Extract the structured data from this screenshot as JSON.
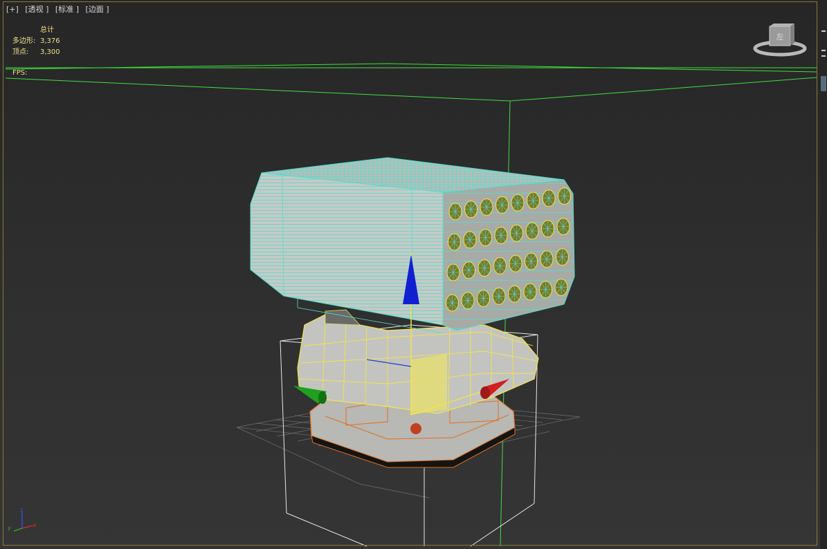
{
  "viewport": {
    "labels": [
      "[+]",
      "[透视 ]",
      "[标准 ]",
      "[边面 ]"
    ],
    "stats": {
      "header": "总计",
      "rows": [
        {
          "label": "多边形:",
          "value": "3,376"
        },
        {
          "label": "顶点:",
          "value": "3,300"
        }
      ]
    },
    "fps_label": "FPS:",
    "viewcube_label": "左",
    "axis_labels": {
      "x": "x",
      "y": "y",
      "z": "z"
    }
  },
  "colors": {
    "background": "#2b2b2b",
    "stats_text": "#f0e08a",
    "launcher_wire": "#4fe0d0",
    "base_wire": "#f4e44a",
    "bottom_wire": "#e07020",
    "axis_x": "#d02020",
    "axis_y": "#20a020",
    "axis_z": "#1020d0",
    "grid_green": "#40e040"
  },
  "icons": [
    "viewcube-icon",
    "move-gizmo-icon",
    "axis-tripod-icon"
  ]
}
